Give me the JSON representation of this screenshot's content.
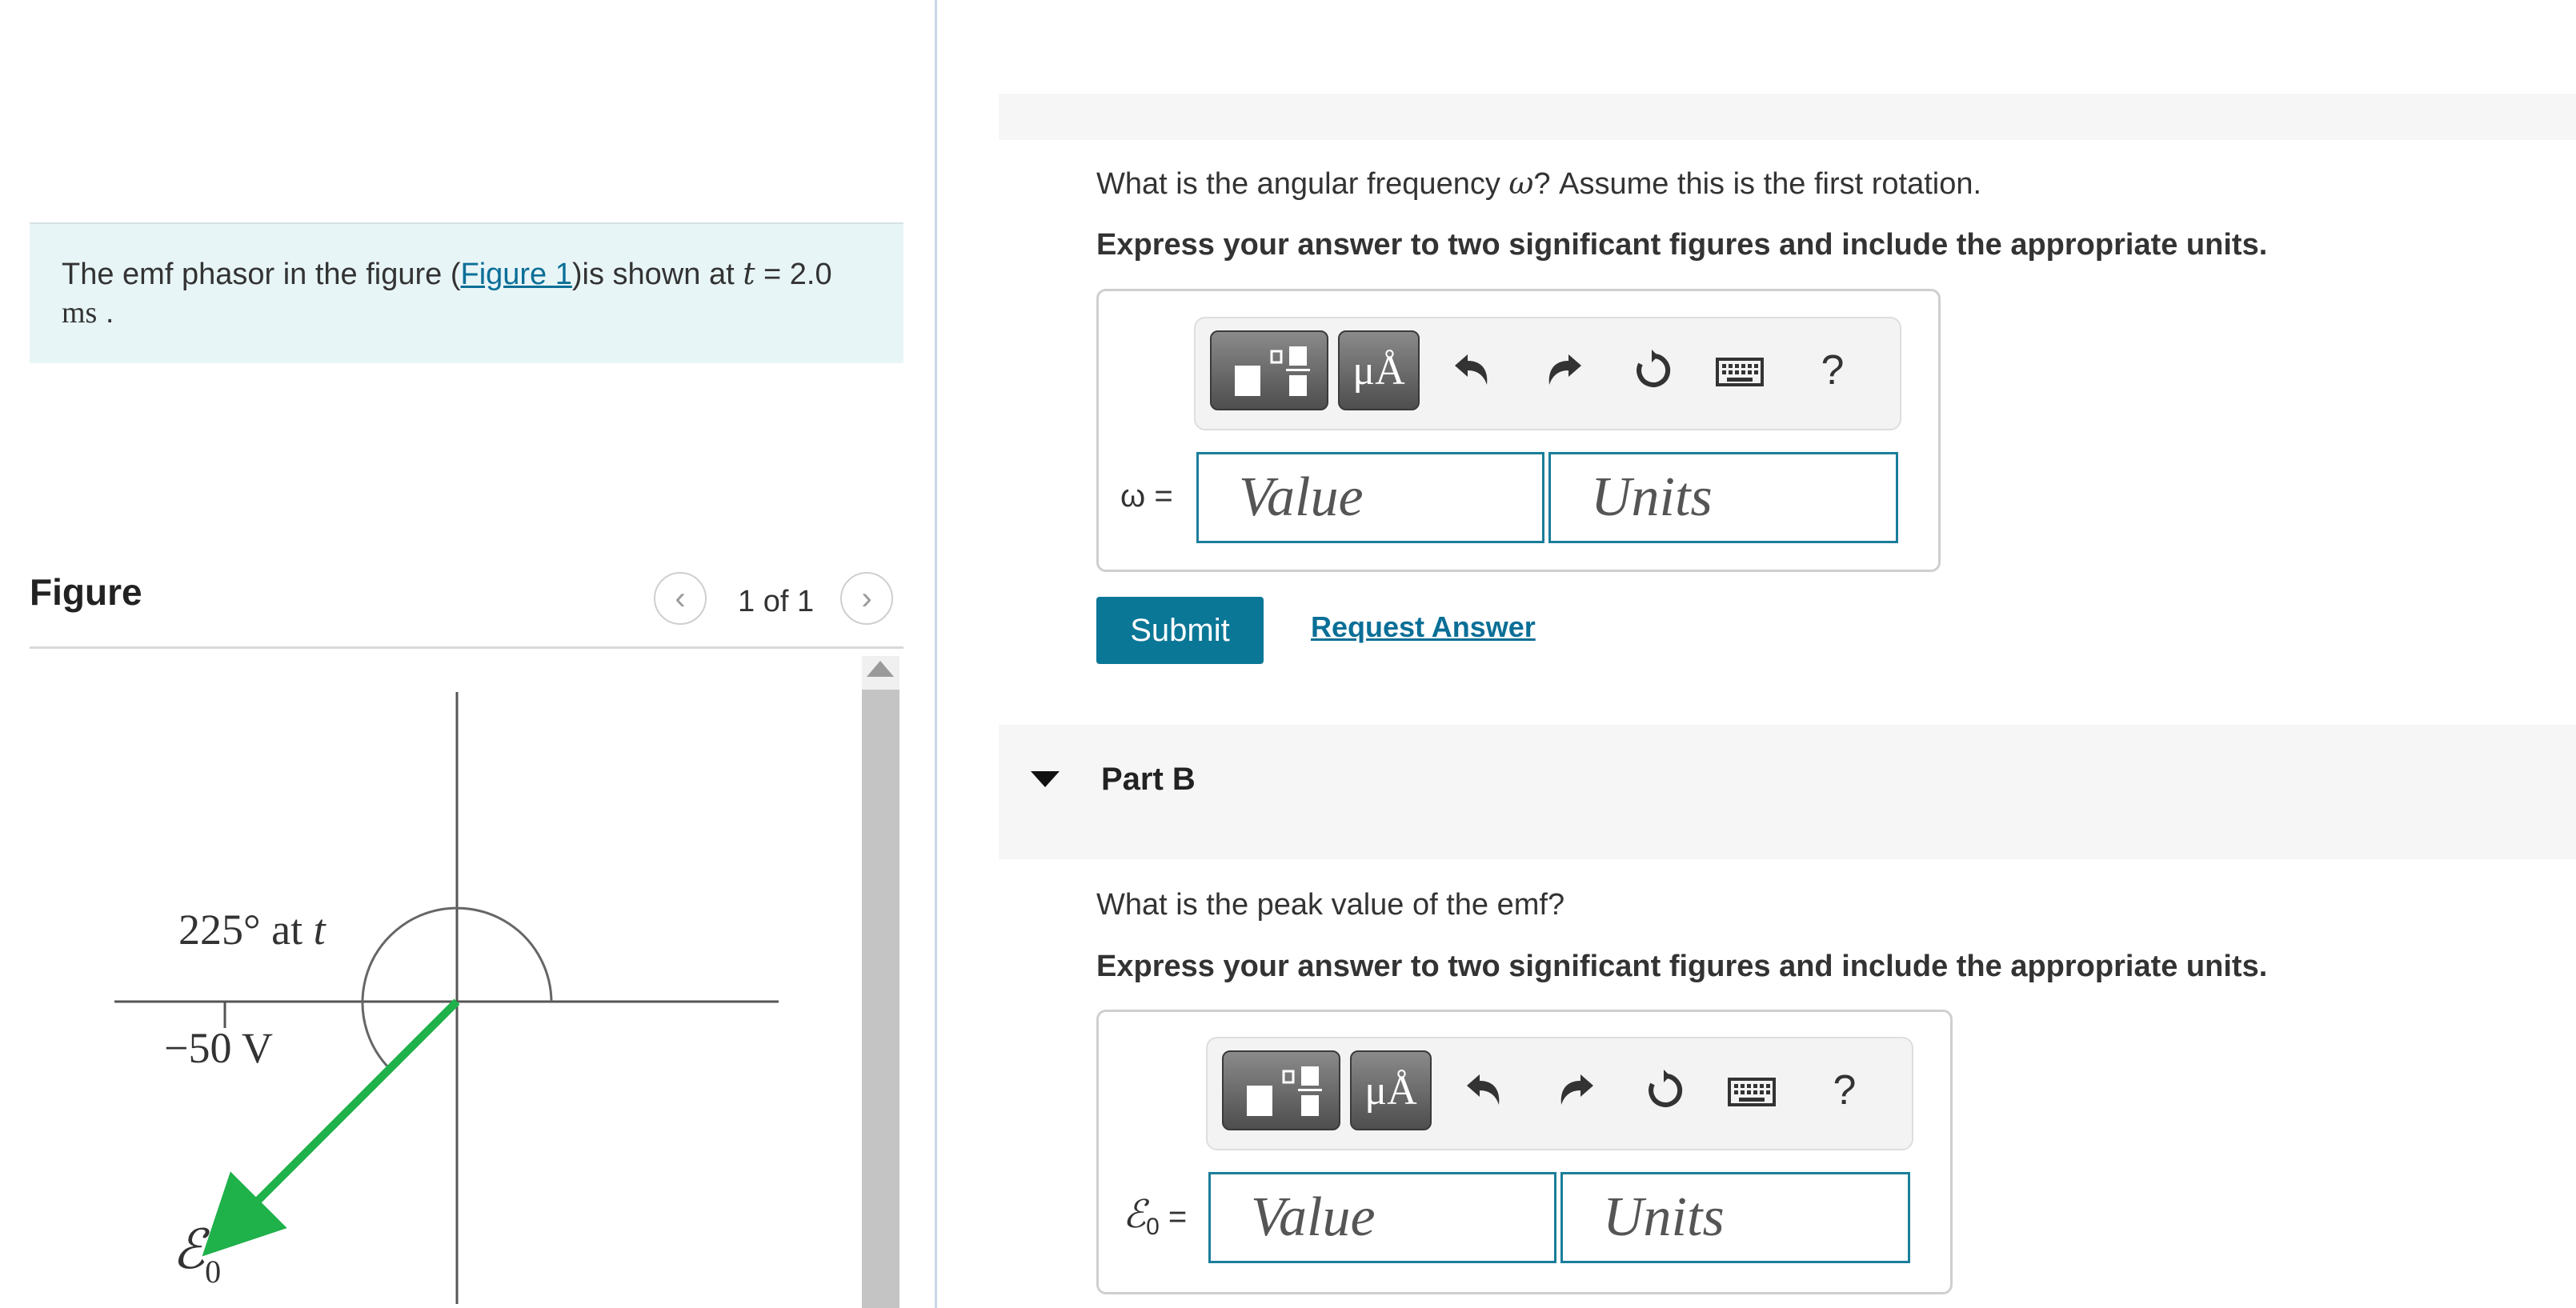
{
  "problem": {
    "text_before": "The emf phasor in the figure (",
    "figure_link": "Figure 1",
    "text_after": ")is shown at ",
    "t_symbol": "t",
    "t_equals": " = 2.0",
    "unit": "ms",
    "period": "."
  },
  "figure_panel": {
    "title": "Figure",
    "count": "1 of 1",
    "prev_glyph": "‹",
    "next_glyph": "›",
    "angle_label": "225° at",
    "angle_t": "t",
    "value_label": "−50 V",
    "emf_symbol": "ℰ",
    "emf_sub": "0",
    "arrow_color": "#1fb14a"
  },
  "part_a": {
    "question_pre": "What is the angular frequency ",
    "omega": "ω",
    "question_post": "? Assume this is the first rotation.",
    "instruction": "Express your answer to two significant figures and include the appropriate units.",
    "var_label": "ω =",
    "value_placeholder": "Value",
    "units_placeholder": "Units",
    "submit": "Submit",
    "request": "Request Answer"
  },
  "part_b": {
    "title": "Part B",
    "question": "What is the peak value of the emf?",
    "instruction": "Express your answer to two significant figures and include the appropriate units.",
    "var_symbol": "ℰ",
    "var_sub": "0",
    "var_eq": " =",
    "value_placeholder": "Value",
    "units_placeholder": "Units"
  },
  "toolbar": {
    "units_button": "μÅ",
    "help": "?"
  },
  "colors": {
    "accent": "#0b7797",
    "problem_bg": "#e8f5f7",
    "field_border": "#1a7e9a"
  }
}
